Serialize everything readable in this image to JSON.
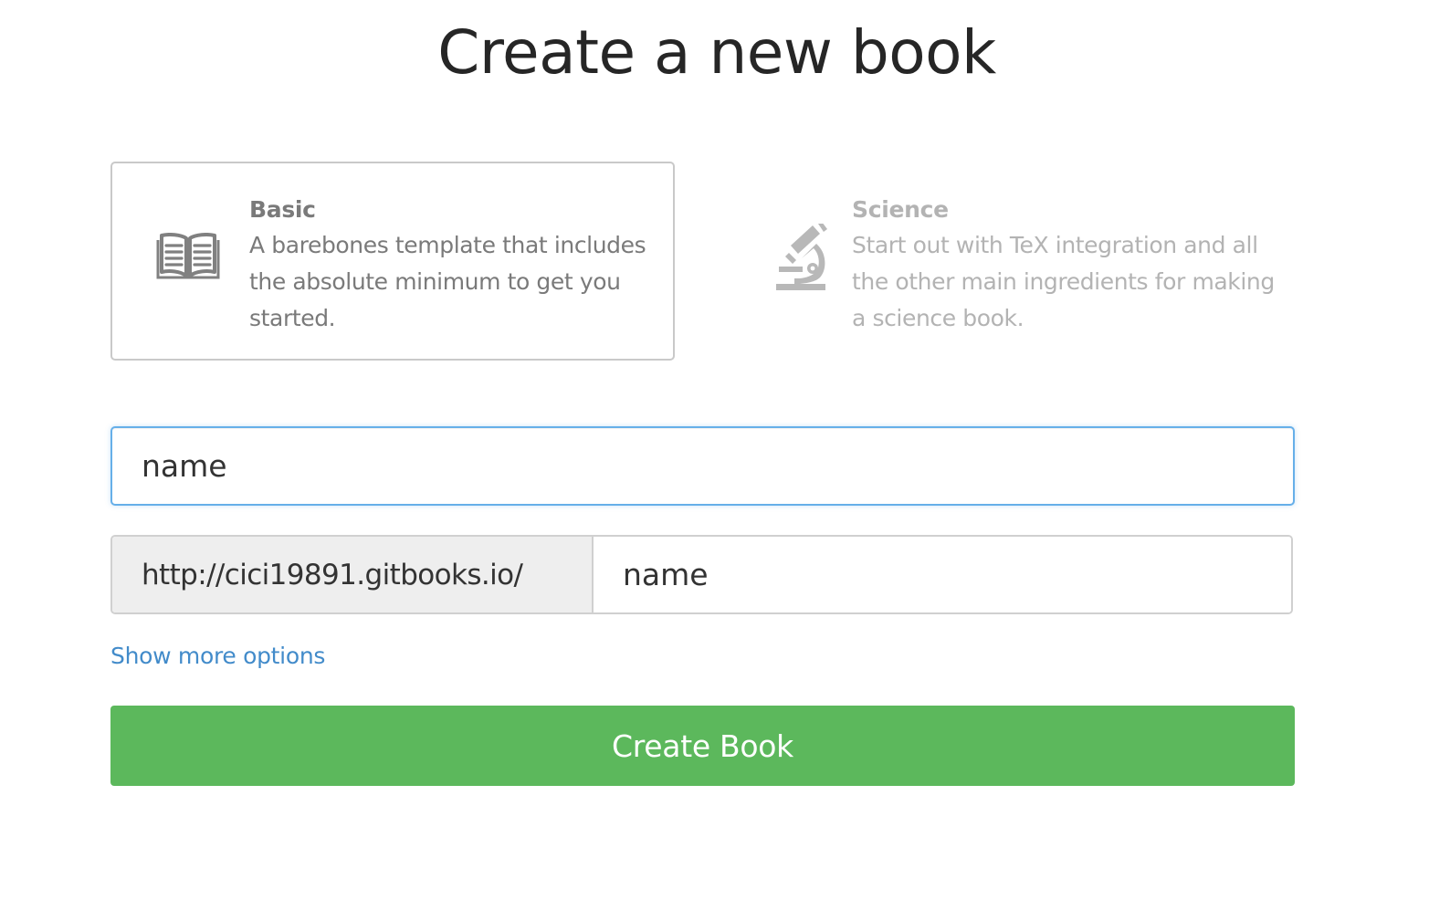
{
  "page": {
    "title": "Create a new book"
  },
  "templates": [
    {
      "name": "Basic",
      "description": "A barebones template that includes the absolute minimum to get you started.",
      "icon": "open-book-icon",
      "selected": true
    },
    {
      "name": "Science",
      "description": "Start out with TeX integration and all the other main ingredients for making a science book.",
      "icon": "microscope-icon",
      "selected": false
    }
  ],
  "form": {
    "name_placeholder": "name",
    "url_prefix": "http://cici19891.gitbooks.io/",
    "slug_placeholder": "name",
    "more_options_label": "Show more options",
    "submit_label": "Create Book"
  },
  "colors": {
    "focus_border": "#66afe9",
    "link": "#428bca",
    "primary_button": "#5cb85c",
    "selected_template_text": "#7a7a7a",
    "unselected_template_text": "#b3b3b3"
  }
}
